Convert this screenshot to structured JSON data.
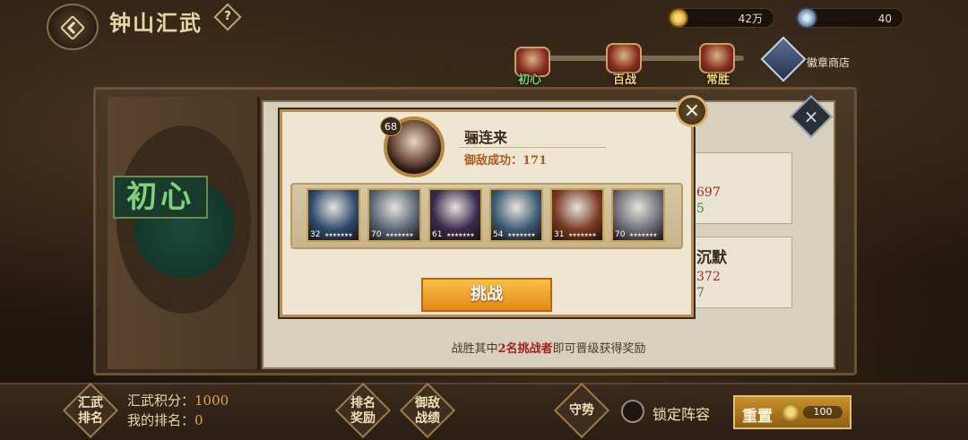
{
  "header": {
    "title": "钟山汇武",
    "help_label": "?",
    "gold_amount": "42万",
    "gem_amount": "40",
    "shop_label": "徽章商店"
  },
  "tiers": [
    {
      "label": "初心",
      "color": "#7bd36c"
    },
    {
      "label": "百战",
      "color": "#f1d26a"
    },
    {
      "label": "常胜",
      "color": "#f1d26a"
    }
  ],
  "board": {
    "current_tier": "初心",
    "right_cards": [
      {
        "line1": "",
        "line2": "697",
        "line3": "5"
      },
      {
        "line1": "沉默",
        "line2": "372",
        "line3": "7"
      }
    ],
    "hint_pre": "战胜其中",
    "hint_highlight": "2名挑战者",
    "hint_post": "即可晋级获得奖励"
  },
  "modal": {
    "close_label": "×",
    "level": "68",
    "opponent_name": "骊连来",
    "defense_label": "御敌成功：",
    "defense_value": "171",
    "heroes": [
      {
        "level": "32",
        "stars": "★★★★★★★",
        "bg": "#2e4a6e"
      },
      {
        "level": "70",
        "stars": "★★★★★★★",
        "bg": "#5a6878"
      },
      {
        "level": "61",
        "stars": "★★★★★★★",
        "bg": "#3a2a4e"
      },
      {
        "level": "54",
        "stars": "★★★★★★★",
        "bg": "#3c5a74"
      },
      {
        "level": "31",
        "stars": "★★★★★★★",
        "bg": "#7a3a24"
      },
      {
        "level": "70",
        "stars": "★★★★★★★",
        "bg": "#6e6e7a"
      }
    ],
    "challenge_label": "挑战"
  },
  "footer": {
    "ranking_label": "汇武排名",
    "score_label": "汇武积分：",
    "score_value": "1000",
    "rank_label": "我的排名：",
    "rank_value": "0",
    "rank_reward_label": "排名奖励",
    "defense_record_label": "御敌战绩",
    "guard_label": "守势",
    "lock_lineup_label": "锁定阵容",
    "reset_label": "重置",
    "reset_cost": "100"
  }
}
